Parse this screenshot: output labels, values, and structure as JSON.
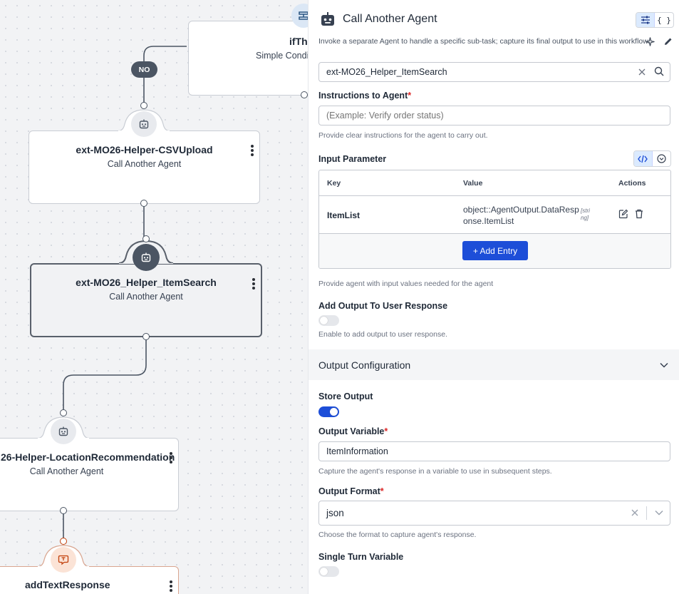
{
  "canvas": {
    "condition_node": {
      "title": "ifTh",
      "subtitle": "Simple Condit"
    },
    "no_label": "NO",
    "nodes": [
      {
        "title": "ext-MO26-Helper-CSVUpload",
        "subtitle": "Call Another Agent"
      },
      {
        "title": "ext-MO26_Helper_ItemSearch",
        "subtitle": "Call Another Agent"
      },
      {
        "title": "26-Helper-LocationRecommendation",
        "subtitle": "Call Another Agent"
      },
      {
        "title": "addTextResponse"
      }
    ]
  },
  "panel": {
    "title": "Call Another Agent",
    "description": "Invoke a separate Agent to handle a specific sub-task; capture its final output to use in this workflow.",
    "view_toggle": {
      "json_label": "{ }"
    },
    "agent_search": {
      "value": "ext-MO26_Helper_ItemSearch"
    },
    "instructions": {
      "label": "Instructions to Agent",
      "required_mark": "*",
      "placeholder": "(Example: Verify order status)",
      "help": "Provide clear instructions for the agent to carry out."
    },
    "input_parameter": {
      "label": "Input Parameter",
      "columns": {
        "key": "Key",
        "value": "Value",
        "actions": "Actions"
      },
      "rows": [
        {
          "key": "ItemList",
          "value_line1": "object::AgentOutput.DataResp",
          "value_line2": "onse.ItemList",
          "type_line1": "[stri",
          "type_line2": "ng]"
        }
      ],
      "add_entry": "+ Add Entry",
      "help": "Provide agent with input values needed for the agent"
    },
    "add_output": {
      "label": "Add Output To User Response",
      "enabled": false,
      "help": "Enable to add output to user response."
    },
    "output_configuration": {
      "title": "Output Configuration",
      "store_output": {
        "label": "Store Output",
        "enabled": true
      },
      "output_variable": {
        "label": "Output Variable",
        "required_mark": "*",
        "value": "ItemInformation",
        "help": "Capture the agent's response in a variable to use in subsequent steps."
      },
      "output_format": {
        "label": "Output Format",
        "required_mark": "*",
        "value": "json",
        "help": "Choose the format to capture agent's response."
      },
      "single_turn": {
        "label": "Single Turn Variable",
        "enabled": false
      }
    }
  },
  "colors": {
    "accent": "#1d4ed8",
    "required": "#dc2626",
    "selected_node_border": "#59606b",
    "text_node_border": "#d9a58f",
    "text_node_badge": "#fbe3d6",
    "text_node_icon": "#c2410c",
    "active_toggle_bg": "#dbeafe"
  },
  "icons": {
    "agent": "robot-icon",
    "condition": "split-icon",
    "text_response": "message-text-icon",
    "clear": "close-icon",
    "search": "search-icon",
    "form_view": "sliders-icon",
    "generate": "sparkle-icon",
    "edit": "pencil-icon",
    "code": "code-icon",
    "expand": "chevron-down-circle-icon",
    "row_edit": "edit-icon",
    "row_delete": "trash-icon",
    "collapse": "chevron-down-icon"
  }
}
